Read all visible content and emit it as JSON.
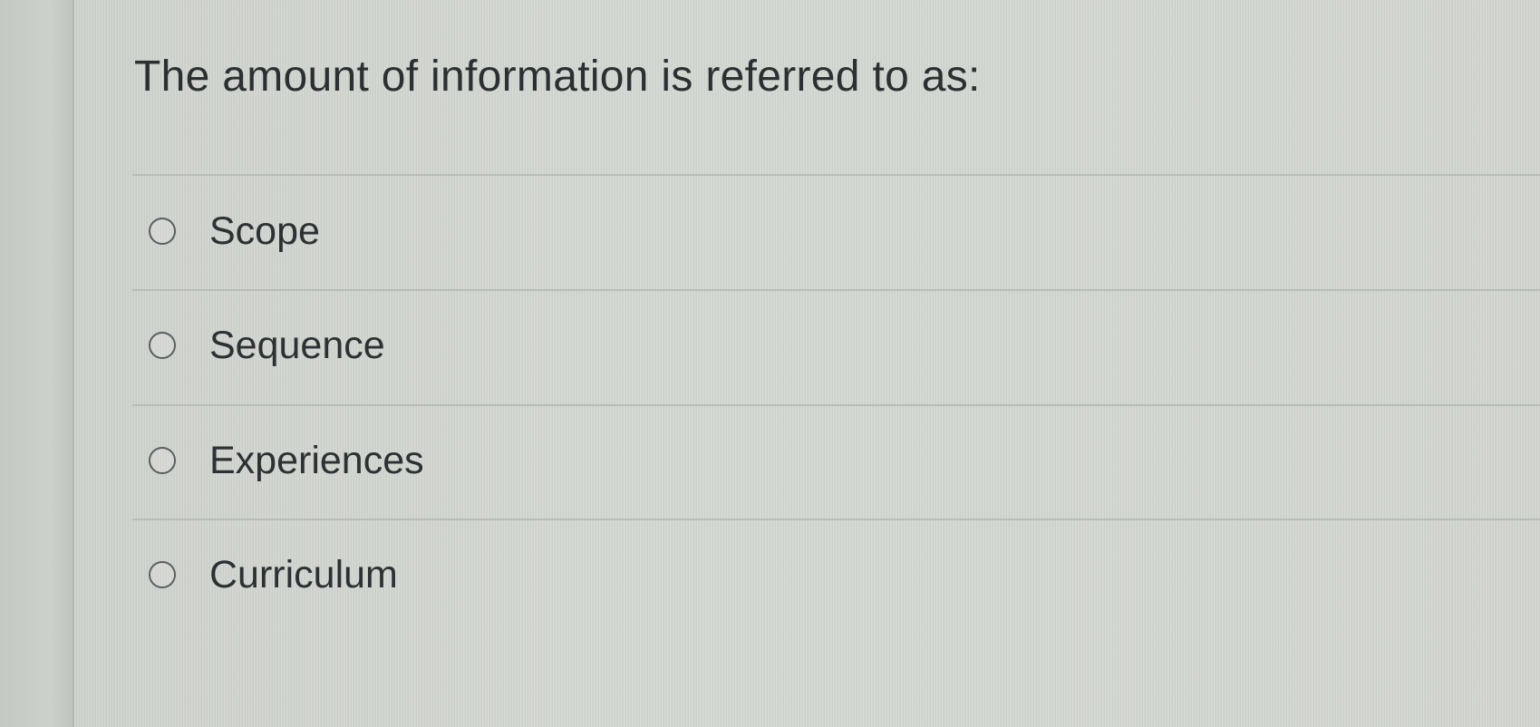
{
  "question": {
    "title": "The amount of information is referred to as:"
  },
  "options": [
    {
      "label": "Scope",
      "selected": false
    },
    {
      "label": "Sequence",
      "selected": false
    },
    {
      "label": "Experiences",
      "selected": false
    },
    {
      "label": "Curriculum",
      "selected": false
    }
  ]
}
